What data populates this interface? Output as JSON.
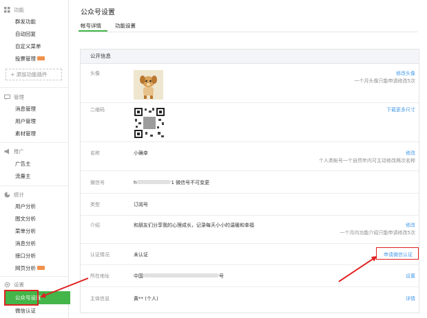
{
  "sidebar": {
    "sections": [
      {
        "title": "功能",
        "icon": "grid-icon"
      },
      {
        "title": "管理",
        "icon": "chat-icon"
      },
      {
        "title": "推广",
        "icon": "megaphone-icon"
      },
      {
        "title": "统计",
        "icon": "chart-icon"
      },
      {
        "title": "设置",
        "icon": "gear-icon"
      }
    ],
    "items": {
      "mass_send": "群发功能",
      "auto_reply": "自动回复",
      "custom_menu": "自定义菜单",
      "vote": "投票管理",
      "add_plugin": "+ 添加功能插件",
      "messages": "消息管理",
      "users": "用户管理",
      "materials": "素材管理",
      "advertiser": "广告主",
      "publisher": "流量主",
      "user_analysis": "用户分析",
      "article_analysis": "图文分析",
      "menu_analysis": "菜单分析",
      "message_analysis": "消息分析",
      "api_analysis": "接口分析",
      "web_analysis": "网页分析",
      "account_settings": "公众号设置",
      "wechat_verify": "微信认证"
    },
    "new_badge_color": "#f0914b",
    "active_color": "#44b549"
  },
  "header": {
    "page_title": "公众号设置",
    "tabs": [
      {
        "label": "帐号详情",
        "active": true
      },
      {
        "label": "功能设置",
        "active": false
      }
    ]
  },
  "panel": {
    "section_title": "公开信息",
    "rows": {
      "avatar": {
        "label": "头像",
        "action": "修改头像",
        "hint": "一个月头像只能申请修改5次",
        "icon": "avatar-image"
      },
      "qrcode": {
        "label": "二维码",
        "action": "下载更多尺寸",
        "icon": "qr-code-image"
      },
      "name": {
        "label": "名称",
        "value": "小确幸",
        "action": "修改",
        "hint": "个人类帐号一个自然年内可主动修改两次名称"
      },
      "wechat_id": {
        "label": "微信号",
        "value_prefix": "h",
        "value_suffix": "1 微信号不可变更"
      },
      "type": {
        "label": "类型",
        "value": "订阅号"
      },
      "intro": {
        "label": "介绍",
        "value": "和朋友们分享我的心理成长，记录每天小小的温暖和幸福",
        "action": "修改",
        "hint": "一个月内功能介绍只能申请修改5次"
      },
      "verification": {
        "label": "认证情况",
        "value": "未认证",
        "action": "申请微信认证"
      },
      "subject_location": {
        "label": "所在地址",
        "value_prefix": "中国",
        "value_suffix": "号",
        "action": "设置"
      },
      "subject_info": {
        "label": "主体信息",
        "value": "黄** (个人)",
        "action": "详情"
      }
    }
  },
  "colors": {
    "link": "#459ae9",
    "highlight_red": "#e02020"
  }
}
